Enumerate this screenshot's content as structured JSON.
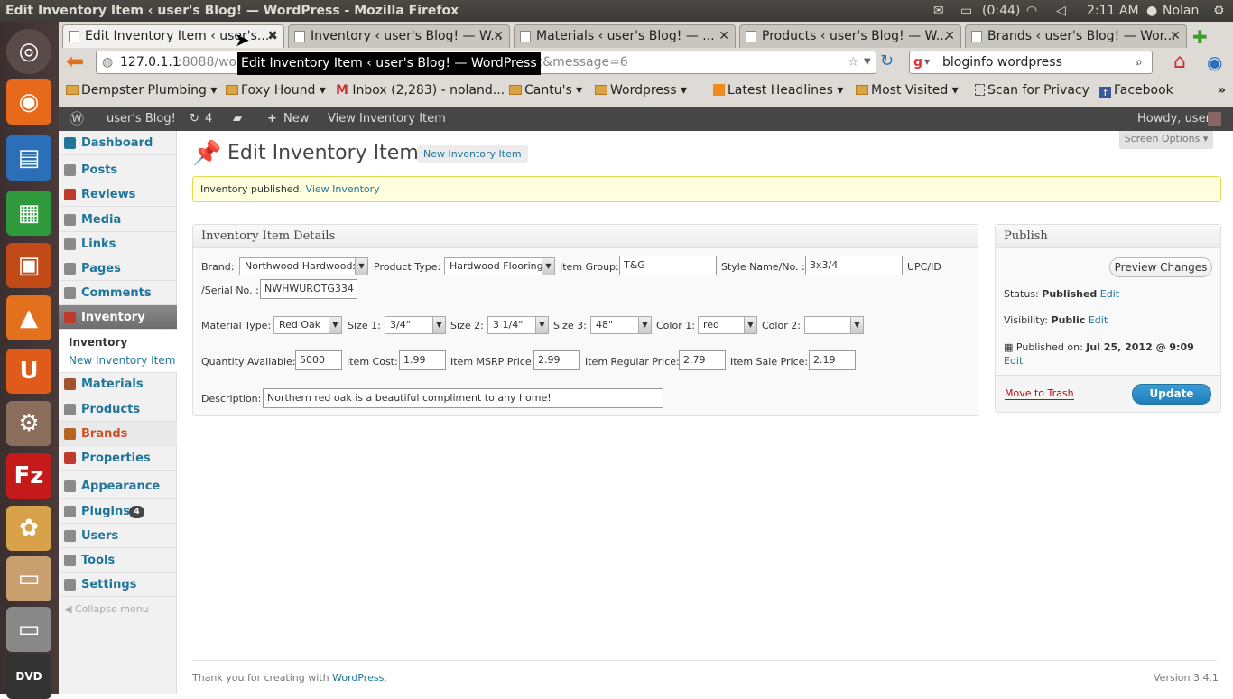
{
  "os": {
    "window_title": "Edit Inventory Item ‹ user's Blog! — WordPress - Mozilla Firefox",
    "battery": "(0:44)",
    "clock": "2:11 AM",
    "user": "Nolan"
  },
  "launcher": {
    "items": [
      "ubuntu-logo",
      "firefox",
      "writer",
      "calc",
      "impress",
      "software-center",
      "ubuntu-one",
      "system-settings",
      "filezilla",
      "picasa",
      "workspaces"
    ]
  },
  "browser": {
    "tabs": [
      {
        "label": "Edit Inventory Item ‹ user's..."
      },
      {
        "label": "Inventory ‹ user's Blog! — W..."
      },
      {
        "label": "Materials ‹ user's Blog! — ..."
      },
      {
        "label": "Products ‹ user's Blog! — W..."
      },
      {
        "label": "Brands ‹ user's Blog! — Wor..."
      }
    ],
    "url_host": "127.0.1.1",
    "url_port": ":8088/wor",
    "url_tail": "dit&message=6",
    "search_value": "bloginfo wordpress",
    "tooltip": "Edit Inventory Item ‹ user's Blog! — WordPress",
    "bookmarks": [
      {
        "label": "Dempster Plumbing"
      },
      {
        "label": "Foxy Hound"
      },
      {
        "label": "Inbox (2,283) - noland..."
      },
      {
        "label": "Cantu's"
      },
      {
        "label": "Wordpress"
      },
      {
        "label": "Latest Headlines"
      },
      {
        "label": "Most Visited"
      },
      {
        "label": "Scan for Privacy"
      },
      {
        "label": "Facebook"
      }
    ]
  },
  "adminbar": {
    "site": "user's Blog!",
    "updates": "4",
    "new": "New",
    "view": "View Inventory Item",
    "howdy": "Howdy, user"
  },
  "sidebar": {
    "items": [
      {
        "label": "Dashboard"
      },
      {
        "label": "Posts"
      },
      {
        "label": "Reviews"
      },
      {
        "label": "Media"
      },
      {
        "label": "Links"
      },
      {
        "label": "Pages"
      },
      {
        "label": "Comments"
      },
      {
        "label": "Inventory"
      },
      {
        "label": "Materials"
      },
      {
        "label": "Products"
      },
      {
        "label": "Brands"
      },
      {
        "label": "Properties"
      },
      {
        "label": "Appearance"
      },
      {
        "label": "Plugins"
      },
      {
        "label": "Users"
      },
      {
        "label": "Tools"
      },
      {
        "label": "Settings"
      }
    ],
    "sub_inventory": "Inventory",
    "sub_new": "New Inventory Item",
    "plugins_badge": "4",
    "collapse": "Collapse menu"
  },
  "main": {
    "title": "Edit Inventory Item",
    "add_new": "New Inventory Item",
    "screen_options": "Screen Options",
    "notice_text": "Inventory published.",
    "notice_link": "View Inventory",
    "details_title": "Inventory Item Details",
    "fields": {
      "brand_label": "Brand:",
      "brand_value": "Northwood Hardwoods",
      "product_type_label": "Product Type:",
      "product_type_value": "Hardwood Flooring",
      "item_group_label": "Item Group:",
      "item_group_value": "T&G",
      "style_label": "Style Name/No. :",
      "style_value": "3x3/4",
      "upc_label": "UPC/ID",
      "serial_label": "/Serial No. :",
      "serial_value": "NWHWUROTG334",
      "material_label": "Material Type:",
      "material_value": "Red Oak",
      "size1_label": "Size 1:",
      "size1_value": "3/4\"",
      "size2_label": "Size 2:",
      "size2_value": "3 1/4\"",
      "size3_label": "Size 3:",
      "size3_value": "48\"",
      "color1_label": "Color 1:",
      "color1_value": "red",
      "color2_label": "Color 2:",
      "color2_value": "",
      "qty_label": "Quantity Available:",
      "qty_value": "5000",
      "cost_label": "Item Cost:",
      "cost_value": "1.99",
      "msrp_label": "Item MSRP Price:",
      "msrp_value": "2.99",
      "regular_label": "Item Regular Price:",
      "regular_value": "2.79",
      "sale_label": "Item Sale Price:",
      "sale_value": "2.19",
      "desc_label": "Description:",
      "desc_value": "Northern red oak is a beautiful compliment to any home!"
    },
    "publish": {
      "title": "Publish",
      "preview": "Preview Changes",
      "status_label": "Status:",
      "status_value": "Published",
      "edit": "Edit",
      "visibility_label": "Visibility:",
      "visibility_value": "Public",
      "published_on_label": "Published on:",
      "published_on_value": "Jul 25, 2012 @ 9:09",
      "trash": "Move to Trash",
      "update": "Update"
    },
    "footer_text": "Thank you for creating with",
    "footer_link": "WordPress",
    "version": "Version 3.4.1"
  },
  "colors": {
    "accent": "#21759b",
    "update_button": "#2e8bc7",
    "trash": "#bc0b0b",
    "notice_bg": "#ffffe0"
  }
}
